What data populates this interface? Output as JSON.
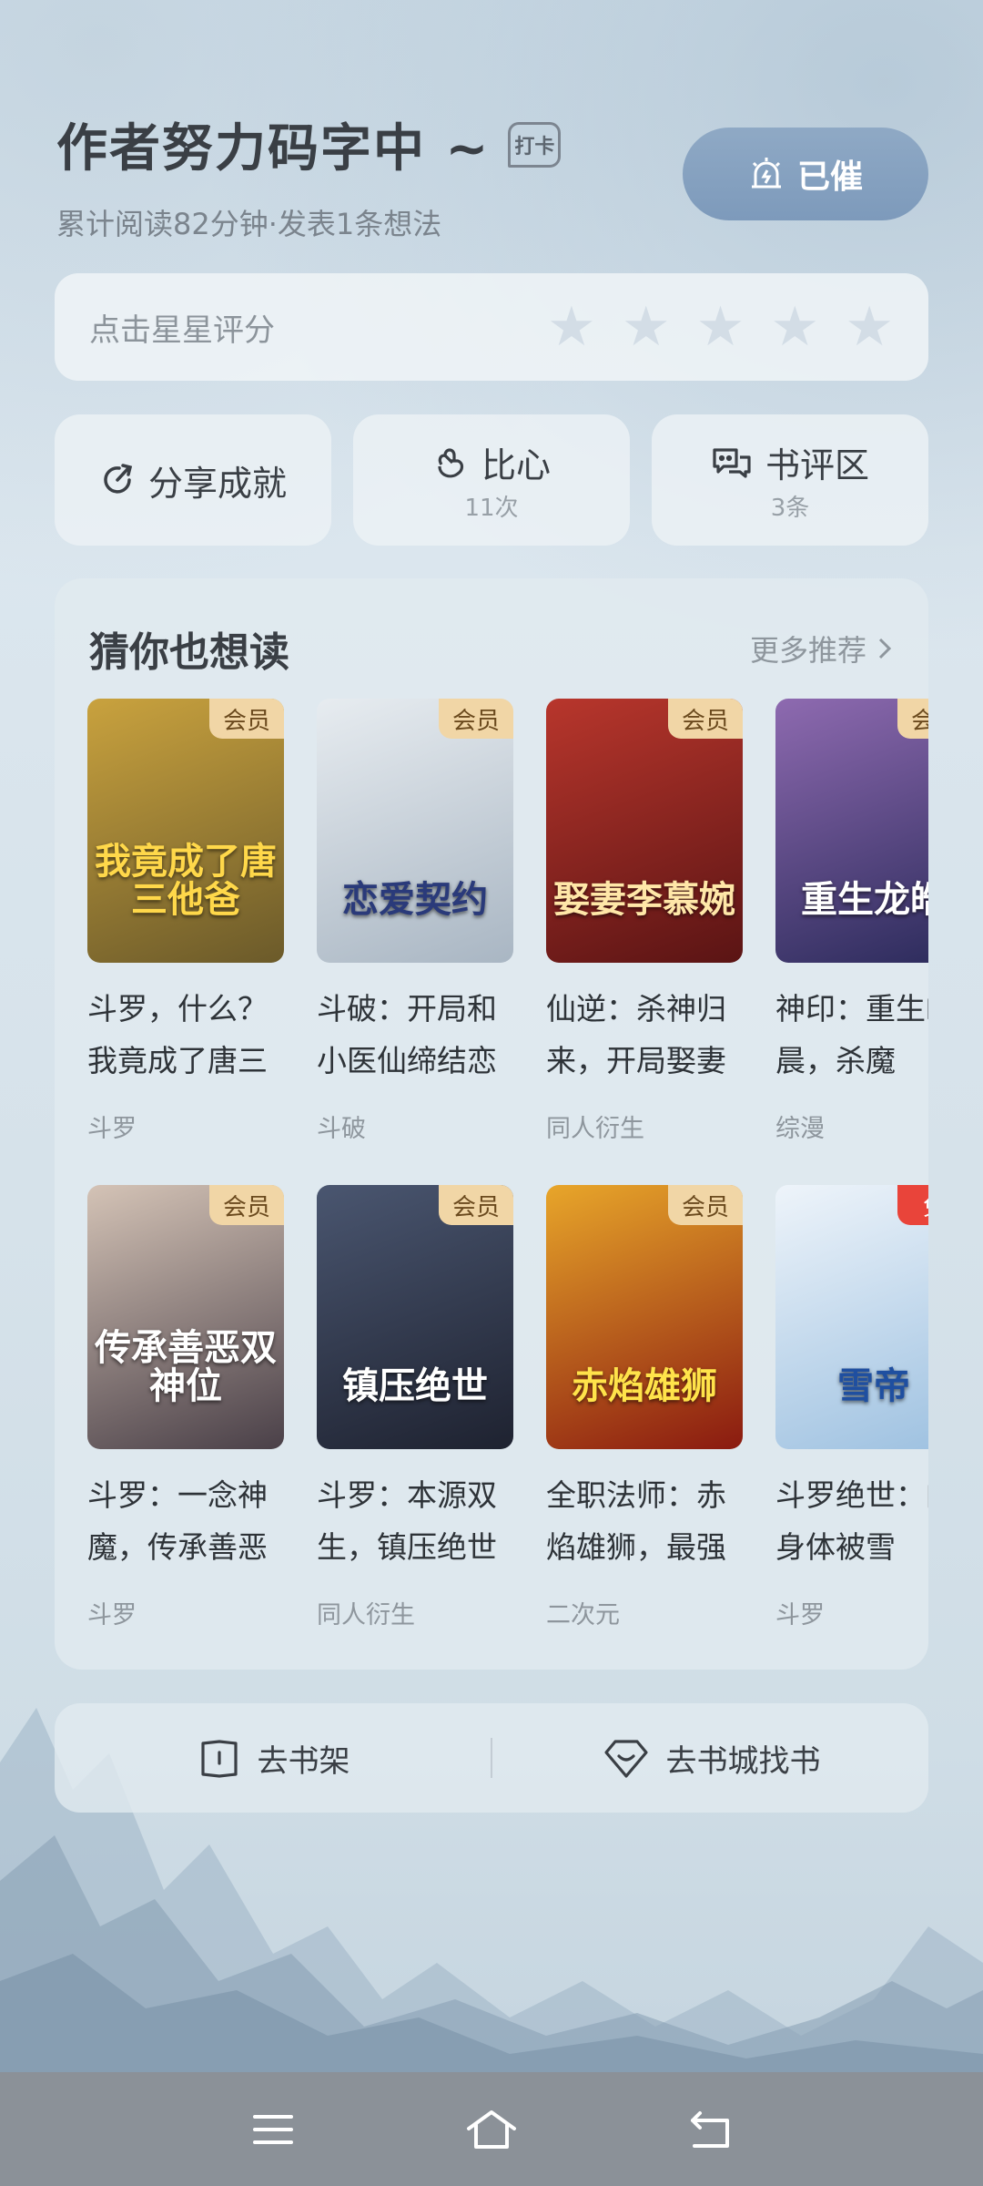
{
  "header": {
    "title": "作者努力码字中 ~",
    "checkin_label": "打卡",
    "subtitle": "累计阅读82分钟·发表1条想法",
    "urged_label": "已催"
  },
  "rating": {
    "label": "点击星星评分",
    "stars": 5,
    "value": 0
  },
  "actions": {
    "share": {
      "label": "分享成就"
    },
    "heart": {
      "label": "比心",
      "count": "11次"
    },
    "review": {
      "label": "书评区",
      "count": "3条"
    }
  },
  "recommend": {
    "title": "猜你也想读",
    "more": "更多推荐",
    "rows": [
      [
        {
          "cover_text": "我竟成了唐三他爸",
          "badge": "会员",
          "title": "斗罗，什么？我竟成了唐三",
          "tag": "斗罗",
          "colors": [
            "#6b5a2a",
            "#c9a23e"
          ],
          "text_color": "#ffd84a"
        },
        {
          "cover_text": "恋爱契约",
          "badge": "会员",
          "title": "斗破：开局和小医仙缔结恋",
          "tag": "斗破",
          "colors": [
            "#a9b6c3",
            "#e7ecf0"
          ],
          "text_color": "#2a3a7a"
        },
        {
          "cover_text": "娶妻李慕婉",
          "badge": "会员",
          "title": "仙逆：杀神归来，开局娶妻",
          "tag": "同人衍生",
          "colors": [
            "#5a1414",
            "#b8362c"
          ],
          "text_color": "#ffe7a8"
        },
        {
          "cover_text": "重生龙皓",
          "badge": "会员",
          "title": "神印：重生皓晨，杀魔",
          "tag": "综漫",
          "colors": [
            "#2a2a5a",
            "#8e6ab0"
          ],
          "text_color": "#ffffff"
        }
      ],
      [
        {
          "cover_text": "传承善恶双神位",
          "badge": "会员",
          "title": "斗罗：一念神魔，传承善恶",
          "tag": "斗罗",
          "colors": [
            "#4a4048",
            "#d4c3b6"
          ],
          "text_color": "#ffffff"
        },
        {
          "cover_text": "镇压绝世",
          "badge": "会员",
          "title": "斗罗：本源双生，镇压绝世",
          "tag": "同人衍生",
          "colors": [
            "#1e2230",
            "#4a5670"
          ],
          "text_color": "#ffffff"
        },
        {
          "cover_text": "赤焰雄狮",
          "badge": "会员",
          "title": "全职法师：赤焰雄狮，最强",
          "tag": "二次元",
          "colors": [
            "#8a1a10",
            "#e8a62a"
          ],
          "text_color": "#ffe34a"
        },
        {
          "cover_text": "雪帝",
          "badge": "免",
          "badge_free": true,
          "title": "斗罗绝世：的身体被雪",
          "tag": "斗罗",
          "colors": [
            "#9cc0e0",
            "#eef4fa"
          ],
          "text_color": "#1f4fa0"
        }
      ]
    ]
  },
  "bottom_bar": {
    "shelf": "去书架",
    "store": "去书城找书"
  },
  "colors": {
    "urged_button": "#839fbf",
    "badge_vip": "#f1d6a6",
    "badge_free": "#e9443a",
    "nav_bar": "#8b9198"
  },
  "nav": {
    "menu_icon": "menu-icon",
    "home_icon": "home-icon",
    "back_icon": "back-icon"
  }
}
